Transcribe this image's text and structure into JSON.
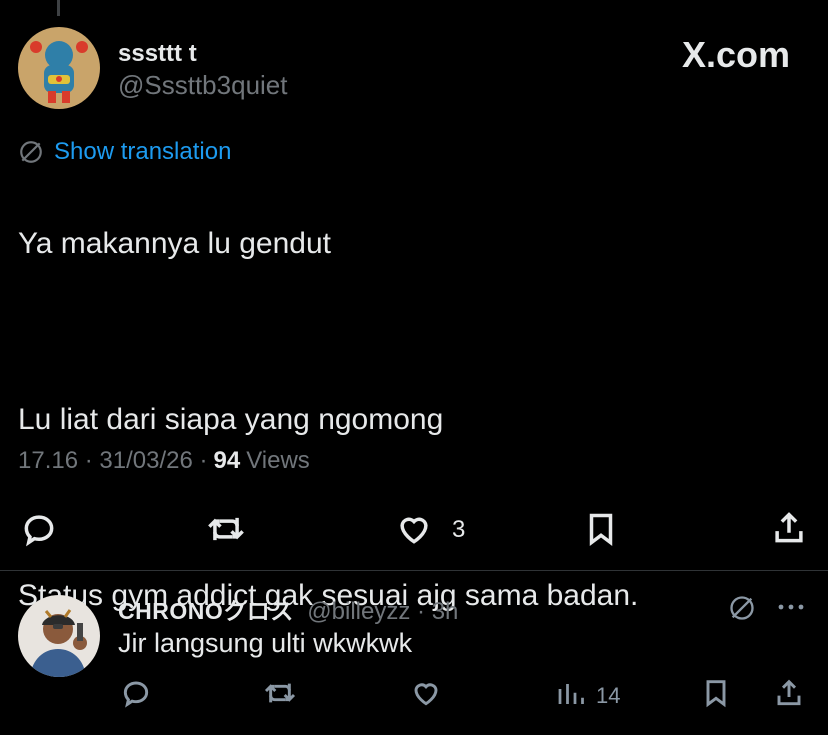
{
  "watermark": "X.com",
  "tweet": {
    "display_name": "sssttt t",
    "handle": "@Sssttb3quiet",
    "show_translation": "Show translation",
    "lines": [
      "Ya makannya lu gendut",
      "Lu liat dari siapa yang ngomong",
      "Status gym addict gak sesuai ajg sama badan."
    ],
    "time": "17.16",
    "date": "31/03/26",
    "views_count": "94",
    "views_label": "Views",
    "like_count": "3"
  },
  "reply": {
    "display_name": "CHRONOクロス",
    "handle": "@billeyzz",
    "time": "3h",
    "text": "Jir langsung ulti wkwkwk",
    "views_count": "14"
  },
  "icons": {
    "tweet_actions": [
      "reply-icon",
      "retweet-icon",
      "like-icon",
      "bookmark-icon",
      "share-icon"
    ],
    "reply_actions": [
      "reply-icon",
      "retweet-icon",
      "like-icon",
      "views-icon",
      "bookmark-icon",
      "share-icon"
    ],
    "header": [
      "translate-icon",
      "more-icon"
    ]
  },
  "colors": {
    "background": "#000000",
    "link": "#1d9bf0",
    "secondary_text": "#71767b"
  }
}
